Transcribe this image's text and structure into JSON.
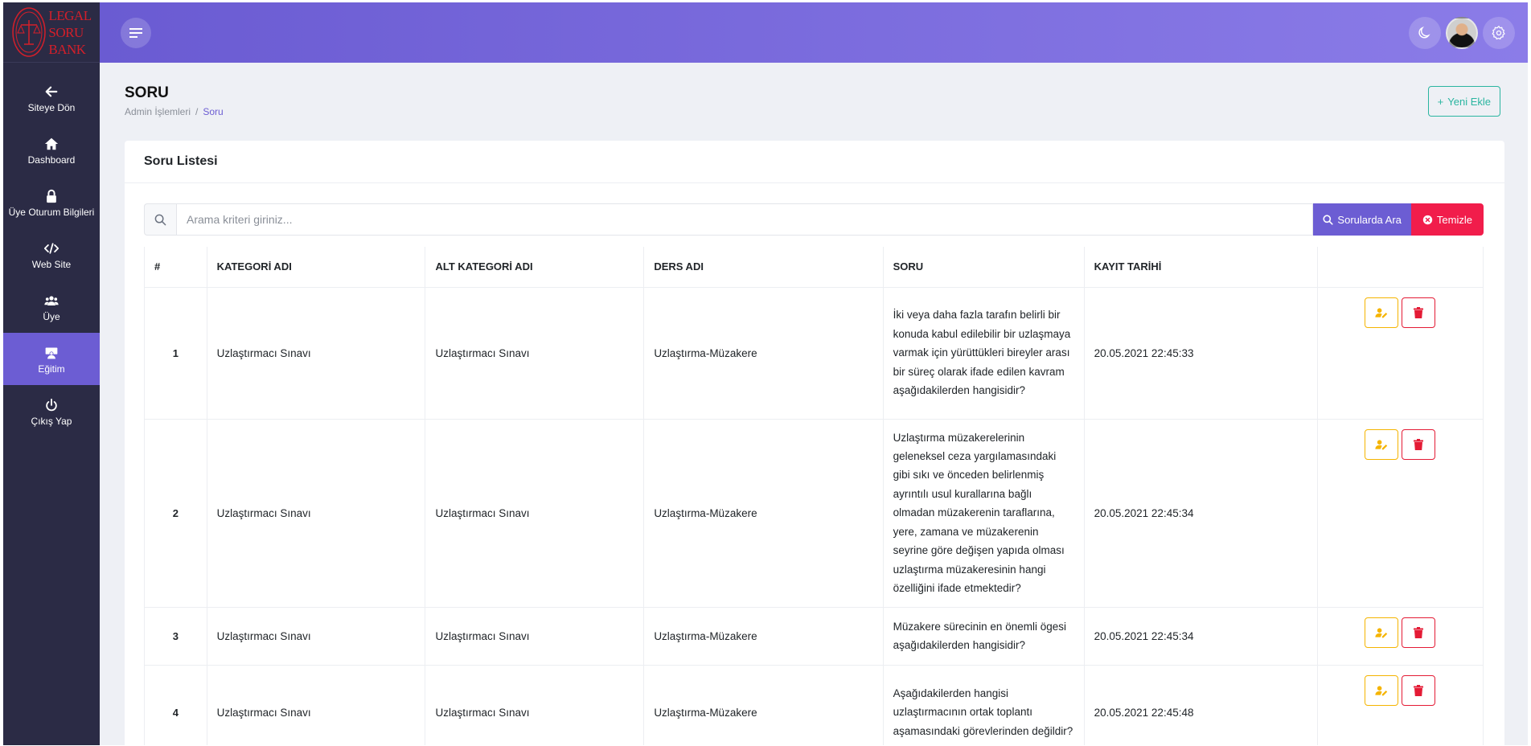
{
  "brand": {
    "logo_lines": [
      "LEGAL",
      "SORU",
      "BANK"
    ],
    "color": "#d41f2a"
  },
  "sidebar": {
    "items": [
      {
        "label": "Siteye Dön",
        "icon": "arrow-left-icon"
      },
      {
        "label": "Dashboard",
        "icon": "home-icon"
      },
      {
        "label": "Üye Oturum Bilgileri",
        "icon": "lock-icon"
      },
      {
        "label": "Web Site",
        "icon": "code-icon"
      },
      {
        "label": "Üye",
        "icon": "users-icon"
      },
      {
        "label": "Eğitim",
        "icon": "graduation-cap-icon",
        "active": true
      },
      {
        "label": "Çıkış Yap",
        "icon": "power-icon"
      }
    ]
  },
  "header": {
    "icons": [
      "menu-icon",
      "moon-icon",
      "avatar",
      "gear-icon"
    ]
  },
  "page": {
    "title": "SORU",
    "breadcrumb": [
      "Admin İşlemleri",
      "Soru"
    ],
    "add_button": "Yeni Ekle"
  },
  "card": {
    "title": "Soru Listesi",
    "search": {
      "placeholder": "Arama kriteri giriniz...",
      "value": ""
    },
    "search_button": "Sorularda Ara",
    "clear_button": "Temizle"
  },
  "table": {
    "headers": [
      "#",
      "KATEGORİ ADI",
      "ALT KATEGORİ ADI",
      "DERS ADI",
      "SORU",
      "KAYIT TARİHİ",
      ""
    ],
    "rows": [
      {
        "num": "1",
        "category": "Uzlaştırmacı Sınavı",
        "subcategory": "Uzlaştırmacı Sınavı",
        "course": "Uzlaştırma-Müzakere",
        "question": "İki veya daha fazla tarafın belirli bir konuda kabul edilebilir bir uzlaşmaya varmak için yürüttükleri bireyler arası bir süreç olarak ifade edilen kavram aşağıdakilerden hangisidir?",
        "date": "20.05.2021 22:45:33"
      },
      {
        "num": "2",
        "category": "Uzlaştırmacı Sınavı",
        "subcategory": "Uzlaştırmacı Sınavı",
        "course": "Uzlaştırma-Müzakere",
        "question": "Uzlaştırma müzakerelerinin geleneksel ceza yargılamasındaki gibi sıkı ve önceden belirlenmiş ayrıntılı usul kurallarına bağlı olmadan müzakerenin taraflarına, yere, zamana ve müzakerenin seyrine göre değişen yapıda olması uzlaştırma müzakeresinin hangi özelliğini ifade etmektedir?",
        "date": "20.05.2021 22:45:34"
      },
      {
        "num": "3",
        "category": "Uzlaştırmacı Sınavı",
        "subcategory": "Uzlaştırmacı Sınavı",
        "course": "Uzlaştırma-Müzakere",
        "question": "Müzakere sürecinin en önemli ögesi aşağıdakilerden hangisidir?",
        "date": "20.05.2021 22:45:34"
      },
      {
        "num": "4",
        "category": "Uzlaştırmacı Sınavı",
        "subcategory": "Uzlaştırmacı Sınavı",
        "course": "Uzlaştırma-Müzakere",
        "question": "Aşağıdakilerden hangisi uzlaştırmacının ortak toplantı aşamasındaki görevlerinden değildir?",
        "date": "20.05.2021 22:45:48"
      }
    ]
  },
  "colors": {
    "sidebar_bg": "#2b2b45",
    "accent": "#6c5dd3",
    "danger": "#f11d4b",
    "success": "#2ab5a0",
    "warning": "#f5b400"
  }
}
